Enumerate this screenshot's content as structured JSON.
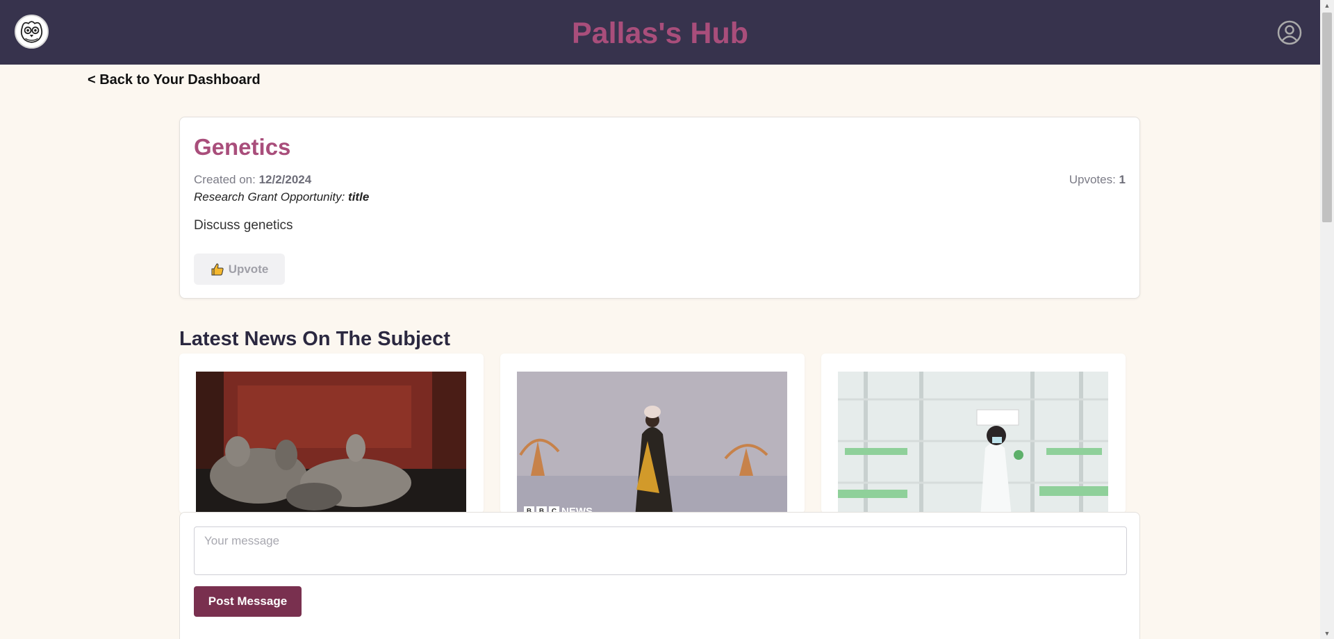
{
  "header": {
    "title": "Pallas's Hub",
    "logo_icon": "owl-logo-icon",
    "profile_icon": "user-circle-icon",
    "background": "#37334d",
    "title_color": "#a94e7b"
  },
  "back_link": "< Back to Your Dashboard",
  "topic": {
    "title": "Genetics",
    "created_label": "Created on: ",
    "created_date": "12/2/2024",
    "grant_label": "Research Grant Opportunity: ",
    "grant_title": "title",
    "description": "Discuss genetics",
    "upvotes_label": "Upvotes: ",
    "upvotes_count": "1",
    "upvote_button": "Upvote"
  },
  "news": {
    "heading": "Latest News On The Subject",
    "items": [
      {
        "image": "pompeii-casts-photo"
      },
      {
        "image": "woman-walking-flooded-landscape-photo",
        "badge": "NEWS",
        "badge_letters": [
          "B",
          "B",
          "C"
        ]
      },
      {
        "image": "scientist-in-vertical-farm-photo"
      }
    ]
  },
  "composer": {
    "placeholder": "Your message",
    "value": "",
    "post_button": "Post Message",
    "button_color": "#79304f"
  }
}
